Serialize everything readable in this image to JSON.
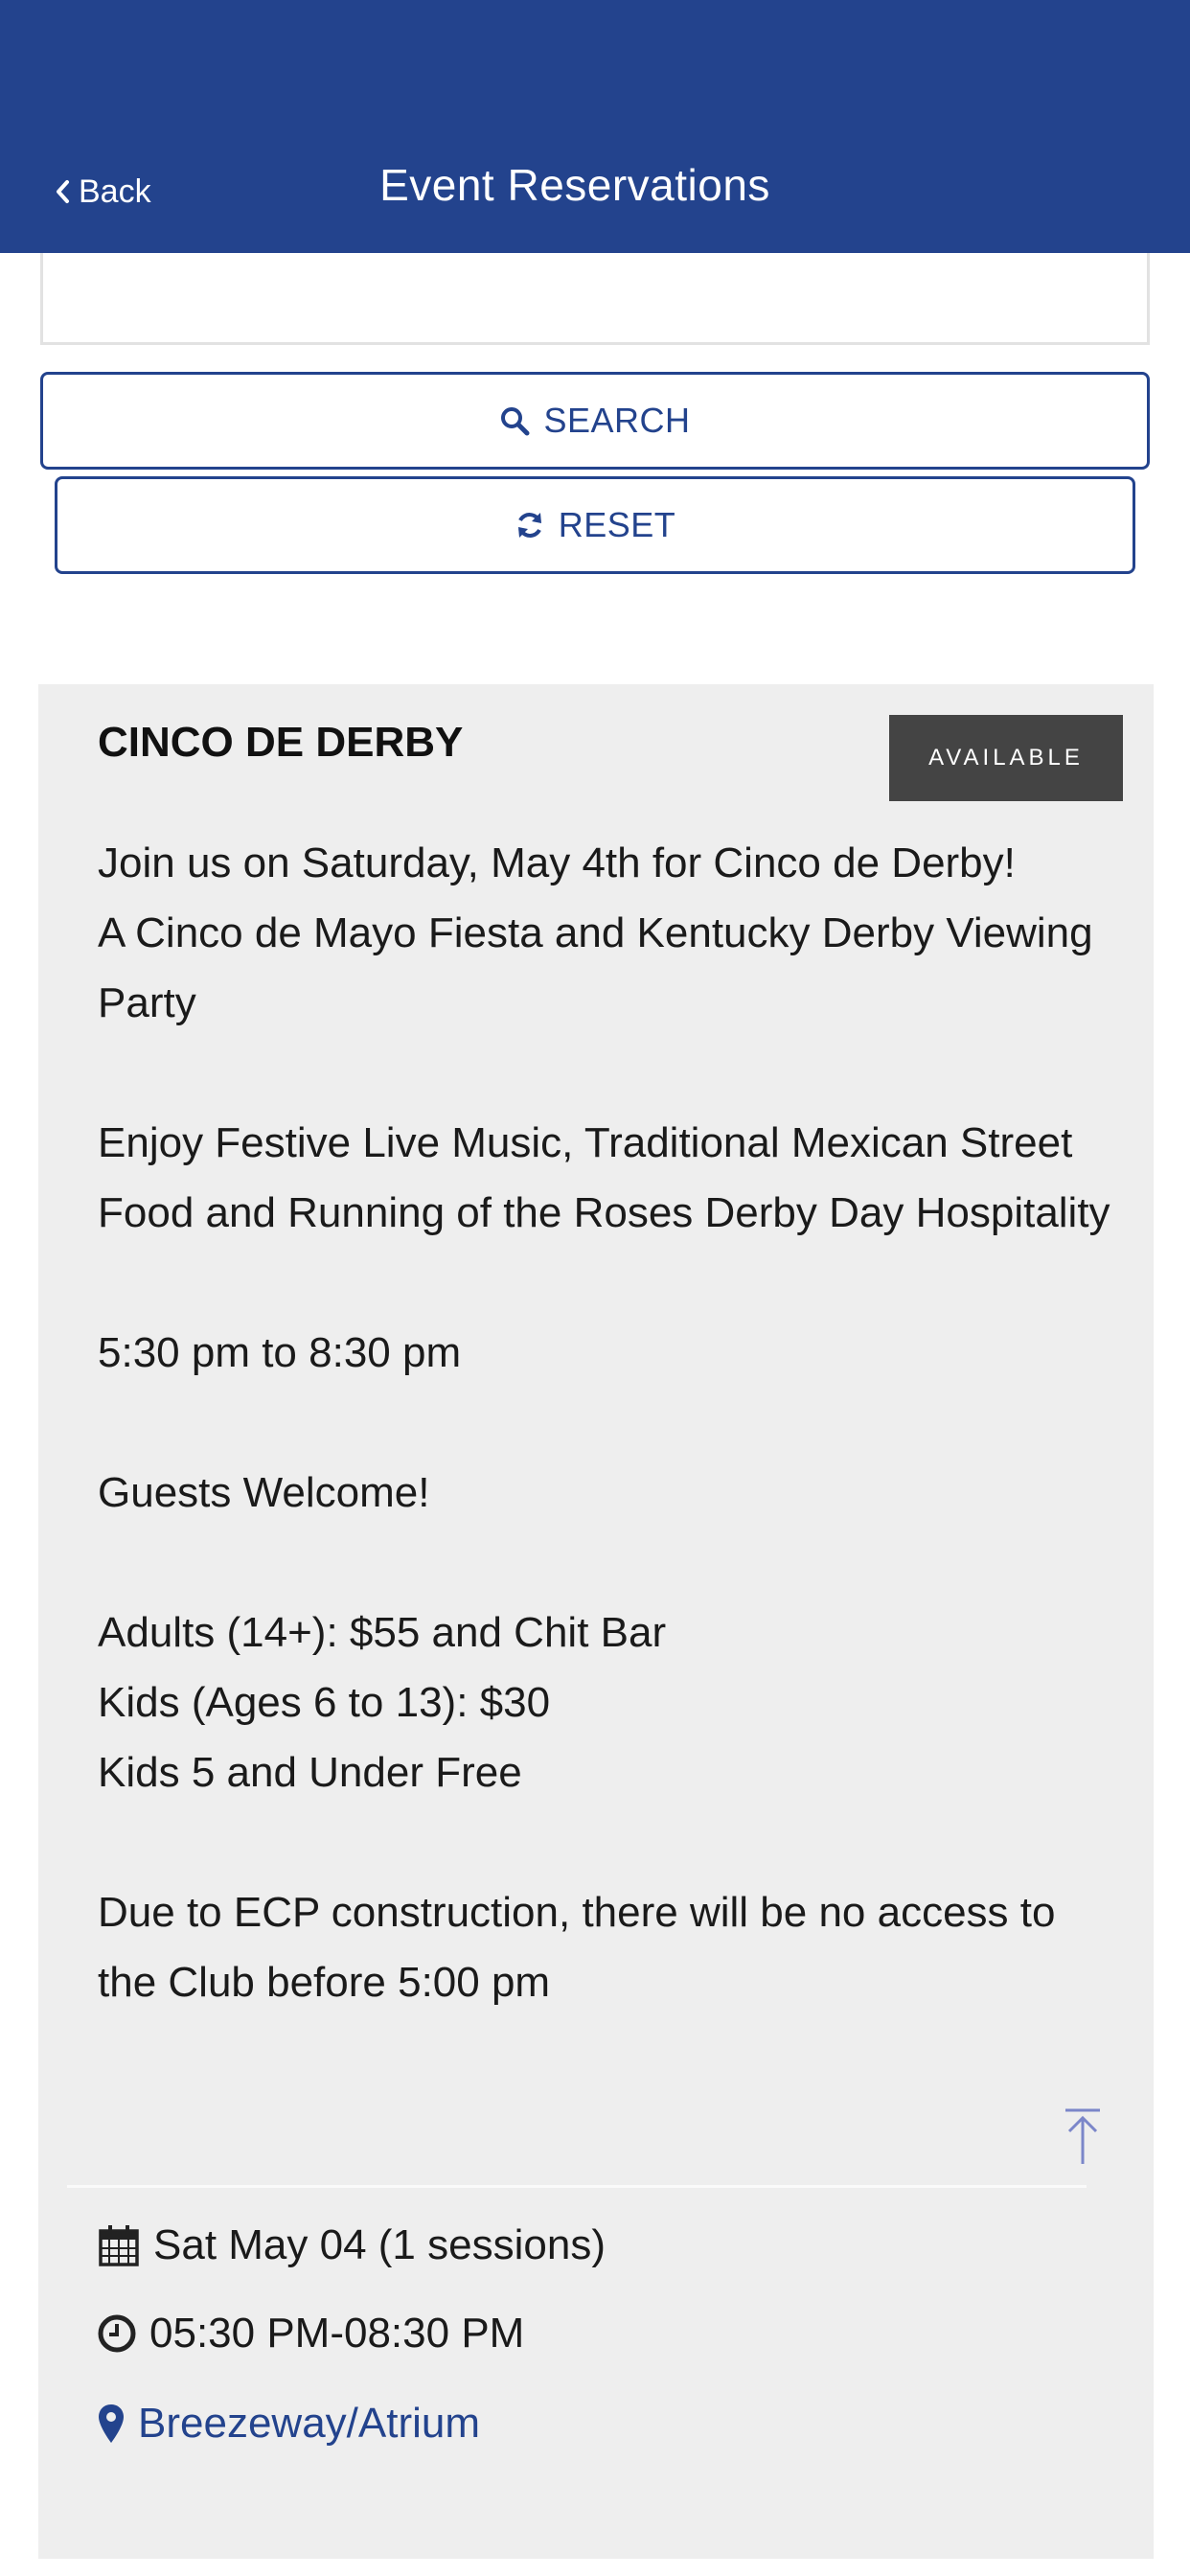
{
  "header": {
    "back_label": "Back",
    "title": "Event Reservations",
    "background": "#23438d"
  },
  "search": {
    "search_label": "SEARCH",
    "reset_label": "RESET"
  },
  "event": {
    "title": "CINCO DE DERBY",
    "status": "AVAILABLE",
    "description": [
      "Join us on Saturday, May 4th for Cinco de Derby!",
      "A Cinco de Mayo Fiesta and Kentucky Derby Viewing Party",
      "Enjoy Festive Live Music, Traditional Mexican Street Food and Running of the Roses Derby Day Hospitality",
      "5:30 pm to 8:30 pm",
      "Guests Welcome!",
      "Adults (14+): $55 and Chit Bar",
      "Kids (Ages 6 to 13): $30",
      "Kids 5 and Under Free",
      "Due to ECP construction, there will be no access to the Club before 5:00 pm"
    ],
    "date": "Sat May 04 (1 sessions)",
    "time": "05:30 PM-08:30 PM",
    "location": "Breezeway/Atrium"
  },
  "icons": {
    "back": "chevron-left-icon",
    "search": "search-icon",
    "reset": "refresh-icon",
    "scroll_top": "arrow-up-to-top-icon",
    "date": "calendar-icon",
    "time": "clock-icon",
    "location": "map-pin-icon"
  },
  "colors": {
    "accent": "#23438d",
    "card_background": "#eeeeee",
    "badge_background": "#444444"
  }
}
